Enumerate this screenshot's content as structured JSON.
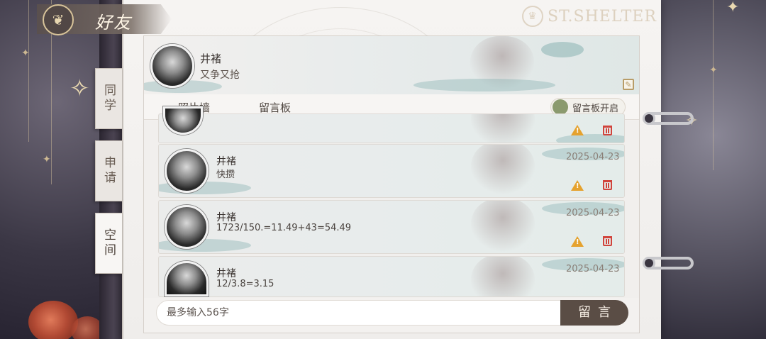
{
  "header": {
    "title": "好友",
    "brand": "ST.SHELTER"
  },
  "side_tabs": [
    {
      "label": "同学",
      "active": false
    },
    {
      "label": "申请",
      "active": false
    },
    {
      "label": "空间",
      "active": true
    }
  ],
  "profile": {
    "name": "井褚",
    "status": "又争又抢"
  },
  "tabs": [
    {
      "label": "照片墙",
      "active": false
    },
    {
      "label": "留言板",
      "active": true
    }
  ],
  "board_toggle": {
    "label": "留言板开启",
    "on": true,
    "color": "#8b9a6e"
  },
  "messages": [
    {
      "name": "井褚",
      "text": "快攒",
      "date": "2025-04-23"
    },
    {
      "name": "井褚",
      "text": "1723/150.=11.49+43=54.49",
      "date": "2025-04-23"
    },
    {
      "name": "井褚",
      "text": "12/3.8=3.15",
      "date": "2025-04-23"
    }
  ],
  "composer": {
    "placeholder": "最多输入56字",
    "send_label": "留言"
  },
  "colors": {
    "accent": "#9b8663",
    "send_button": "#5a4d45",
    "warn": "#e5a22e",
    "delete": "#d1443c"
  }
}
